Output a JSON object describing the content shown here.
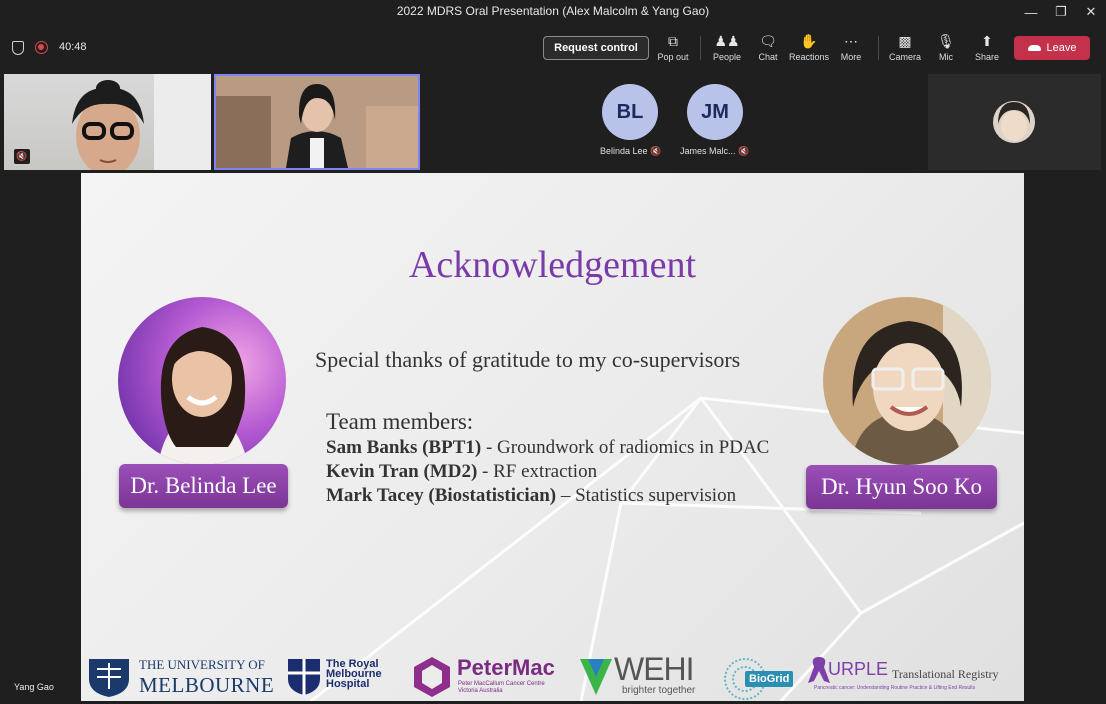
{
  "window": {
    "title": "2022 MDRS Oral Presentation (Alex Malcolm & Yang Gao)"
  },
  "toolbar": {
    "timer": "40:48",
    "request_control": "Request control",
    "buttons": [
      {
        "label": "Pop out",
        "icon": "pop-out-icon"
      },
      {
        "label": "People",
        "icon": "people-icon"
      },
      {
        "label": "Chat",
        "icon": "chat-icon"
      },
      {
        "label": "Reactions",
        "icon": "reactions-icon"
      },
      {
        "label": "More",
        "icon": "more-icon"
      },
      {
        "label": "Camera",
        "icon": "camera-off-icon"
      },
      {
        "label": "Mic",
        "icon": "mic-off-icon"
      },
      {
        "label": "Share",
        "icon": "share-icon"
      }
    ],
    "leave": "Leave",
    "leave_color": "#c4314b"
  },
  "participants": [
    {
      "initials": "BL",
      "name": "Belinda Lee"
    },
    {
      "initials": "JM",
      "name": "James Malc..."
    }
  ],
  "slide": {
    "title": "Acknowledgement",
    "thanks": "Special thanks of gratitude to my co-supervisors",
    "team_heading": "Team members:",
    "team": [
      {
        "name": "Sam Banks  (BPT1)",
        "role": " - Groundwork of radiomics in PDAC"
      },
      {
        "name": "Kevin Tran (MD2)",
        "role": " -  RF extraction"
      },
      {
        "name": "Mark Tacey (Biostatistician)",
        "role": " – Statistics supervision"
      }
    ],
    "left_person": "Dr. Belinda Lee",
    "right_person": "Dr. Hyun Soo Ko",
    "accent_color": "#7a3ba8",
    "logos": {
      "melbourne_1": "THE UNIVERSITY OF",
      "melbourne_2": "MELBOURNE",
      "rmh": "The Royal\nMelbourne\nHospital",
      "petermac": "PeterMac",
      "petermac_sub1": "Peter MacCallum Cancer Centre",
      "petermac_sub2": "Victoria Australia",
      "wehi": "WEHI",
      "wehi_sub": "brighter together",
      "biogrid": "BioGrid",
      "purple": "URPLE",
      "purple_sub": "Translational Registry",
      "purple_tag": "Pancreatic cancer: Understanding Routine Practice & Lifting End Results"
    }
  },
  "presenter_label": "Yang Gao"
}
